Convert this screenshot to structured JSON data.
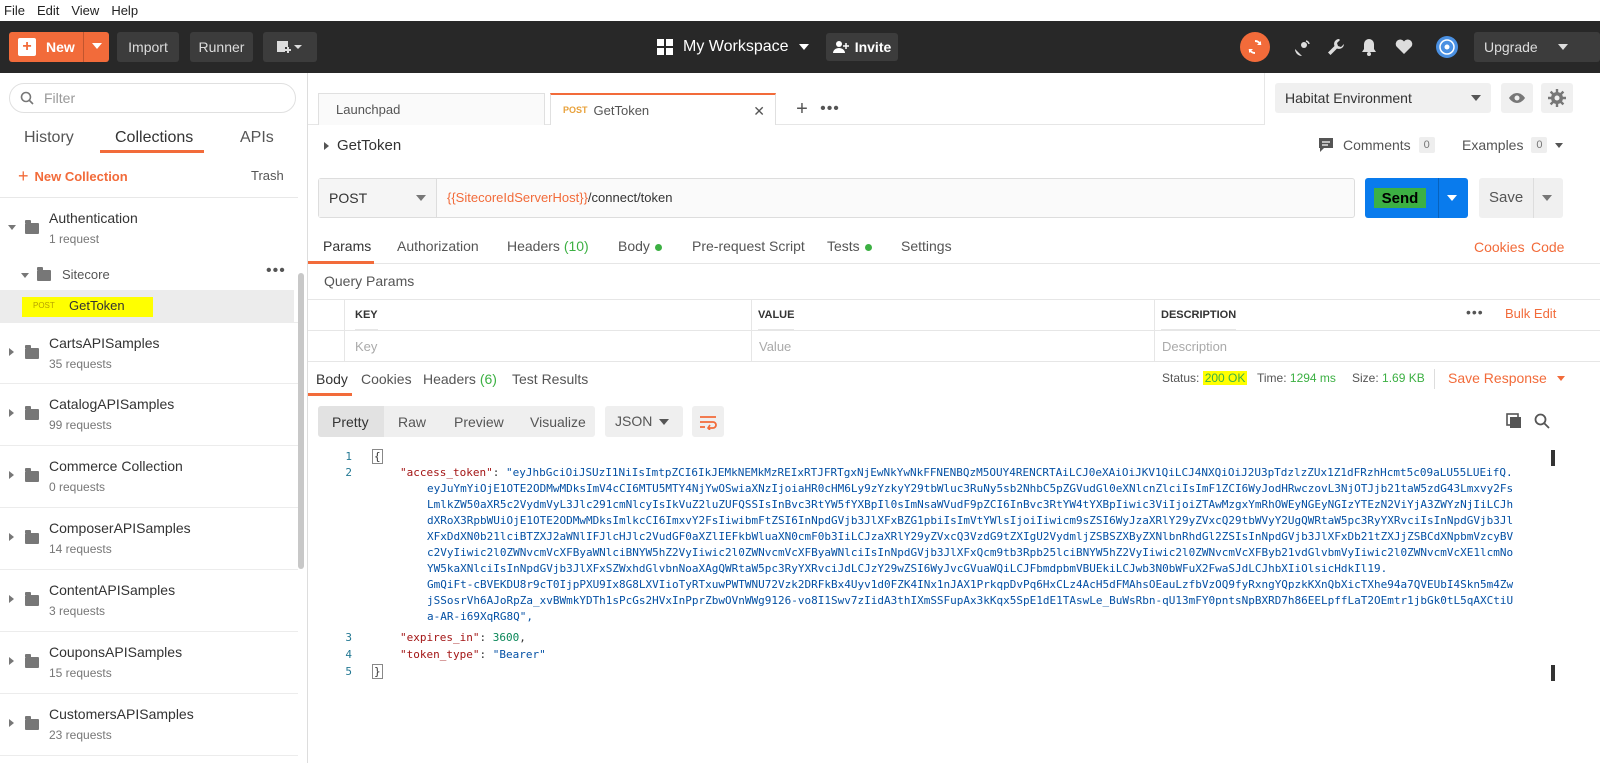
{
  "menu": [
    "File",
    "Edit",
    "View",
    "Help"
  ],
  "header": {
    "new_label": "New",
    "import_label": "Import",
    "runner_label": "Runner",
    "workspace_label": "My Workspace",
    "invite_label": "Invite",
    "upgrade_label": "Upgrade"
  },
  "sidebar": {
    "filter_placeholder": "Filter",
    "tabs": [
      "History",
      "Collections",
      "APIs"
    ],
    "new_collection": "New Collection",
    "trash": "Trash",
    "collections": [
      {
        "name": "Authentication",
        "count": "1 request"
      },
      {
        "name": "CartsAPISamples",
        "count": "35 requests"
      },
      {
        "name": "CatalogAPISamples",
        "count": "99 requests"
      },
      {
        "name": "Commerce Collection",
        "count": "0 requests"
      },
      {
        "name": "ComposerAPISamples",
        "count": "14 requests"
      },
      {
        "name": "ContentAPISamples",
        "count": "3 requests"
      },
      {
        "name": "CouponsAPISamples",
        "count": "15 requests"
      },
      {
        "name": "CustomersAPISamples",
        "count": "23 requests"
      }
    ],
    "subfolder": "Sitecore",
    "selected_request": {
      "method": "POST",
      "name": "GetToken"
    }
  },
  "tabs": [
    {
      "label": "Launchpad"
    },
    {
      "method": "POST",
      "label": "GetToken"
    }
  ],
  "environment": "Habitat Environment",
  "request": {
    "title": "GetToken",
    "comments_label": "Comments",
    "comments_count": "0",
    "examples_label": "Examples",
    "examples_count": "0",
    "method": "POST",
    "url_var": "{{SitecoreIdServerHost}}",
    "url_path": "/connect/token",
    "send_label": "Send",
    "save_label": "Save",
    "tabs": {
      "params": "Params",
      "authorization": "Authorization",
      "headers": "Headers",
      "headers_count": "(10)",
      "body": "Body",
      "prerequest": "Pre-request Script",
      "tests": "Tests",
      "settings": "Settings"
    },
    "cookies": "Cookies",
    "code": "Code",
    "query_params_label": "Query Params",
    "columns": [
      "KEY",
      "VALUE",
      "DESCRIPTION"
    ],
    "placeholders": [
      "Key",
      "Value",
      "Description"
    ],
    "bulk_edit": "Bulk Edit"
  },
  "response": {
    "tabs": {
      "body": "Body",
      "cookies": "Cookies",
      "headers": "Headers",
      "headers_count": "(6)",
      "test_results": "Test Results"
    },
    "status_label": "Status:",
    "status_value": "200 OK",
    "time_label": "Time:",
    "time_value": "1294 ms",
    "size_label": "Size:",
    "size_value": "1.69 KB",
    "save_response": "Save Response",
    "view_modes": [
      "Pretty",
      "Raw",
      "Preview",
      "Visualize"
    ],
    "format": "JSON",
    "line_numbers": [
      "1",
      "2",
      "3",
      "4",
      "5"
    ],
    "open_brace": "{",
    "close_brace": "}",
    "access_token_key": "\"access_token\"",
    "access_token_lines": [
      "\"eyJhbGciOiJSUzI1NiIsImtpZCI6IkJEMkNEMkMzREIxRTJFRTgxNjEwNkYwNkFFNENBQzM5OUY4RENCRTAiLCJ0eXAiOiJKV1QiLCJ4NXQiOiJ2U3pTdzlzZUx1Z1dFRzhHcmt5c09aLU55LUEifQ.",
      "eyJuYmYiOjE1OTE2ODMwMDksImV4cCI6MTU5MTY4NjYwOSwiaXNzIjoiaHR0cHM6Ly9zYzkyY29tbWluc3RuNy5sb2NhbC5pZGVudGl0eXNlcnZlciIsImF1ZCI6WyJodHRwczovL3NjOTJjb21taW5zdG43Lmxvy2Fs",
      "LmlkZW50aXR5c2VydmVyL3Jlc291cmNlcyIsIkVuZ2luZUFQSSIsInBvc3RtYW5fYXBpIl0sImNsaWVudF9pZCI6InBvc3RtYW4tYXBpIiwic3ViIjoiZTAwMzgxYmRhOWEyNGEyNGIzYTEzN2ViYjA3ZWYzNjIiLCJh",
      "dXRoX3RpbWUiOjE1OTE2ODMwMDksImlkcCI6ImxvY2FsIiwibmFtZSI6InNpdGVjb3JlXFxBZG1pbiIsImVtYWlsIjoiIiwicm9sZSI6WyJzaXRlY29yZVxcQ29tbWVyY2UgQWRtaW5pc3RyYXRvciIsInNpdGVjb3Jl",
      "XFxDdXN0b21lciBTZXJ2aWNlIFJlcHJlc2VudGF0aXZlIEFkbWluaXN0cmF0b3IiLCJzaXRlY29yZVxcQ3VzdG9tZXIgU2VydmljZSBSZXByZXNlbnRhdGl2ZSIsInNpdGVjb3JlXFxDb21tZXJjZSBCdXNpbmVzcyBV",
      "c2VyIiwic2l0ZWNvcmVcXFByaWNlciBNYW5hZ2VyIiwic2l0ZWNvcmVcXFByaWNlciIsInNpdGVjb3JlXFxQcm9tb3Rpb25lciBNYW5hZ2VyIiwic2l0ZWNvcmVcXFByb21vdGlvbmVyIiwic2l0ZWNvcmVcXE1lcmNo",
      "YW5kaXNlciIsInNpdGVjb3JlXFxSZWxhdGlvbnNoaXAgQWRtaW5pc3RyYXRvciJdLCJzY29wZSI6WyJvcGVuaWQiLCJFbmdpbmVBUEkiLCJwb3N0bWFuX2FwaSJdLCJhbXIiOlsicHdkIl19.",
      "GmQiFt-cBVEKDU8r9cT0IjpPXU9Ix8G8LXVIioTyRTxuwPWTWNU72Vzk2DRFkBx4Uyv1d0FZK4INx1nJAX1PrkqpDvPq6HxCLz4AcH5dFMAhsOEauLzfbVzOQ9fyRxngYQpzkKXnQbXicTXhe94a7QVEUbI4Skn5m4Zw",
      "jSSosrVh6AJoRpZa_xvBWmkYDTh1sPcGs2HVxInPprZbwOVnWWg9126-vo8I1Swv7zIidA3thIXmSSFupAx3kKqx5SpE1dE1TAswLe_BuWsRbn-qU13mFY0pntsNpBXRD7h86EELpffLaT2OEmtr1jbGk0tL5qAXCtiU",
      "a-AR-i69XqRG8Q\","
    ],
    "expires_in_key": "\"expires_in\"",
    "expires_in_value": "3600",
    "token_type_key": "\"token_type\"",
    "token_type_value": "\"Bearer\""
  },
  "colors": {
    "accent": "#f26b3a",
    "send": "#097bed",
    "success": "#3cb043",
    "highlight": "#ffff00"
  }
}
